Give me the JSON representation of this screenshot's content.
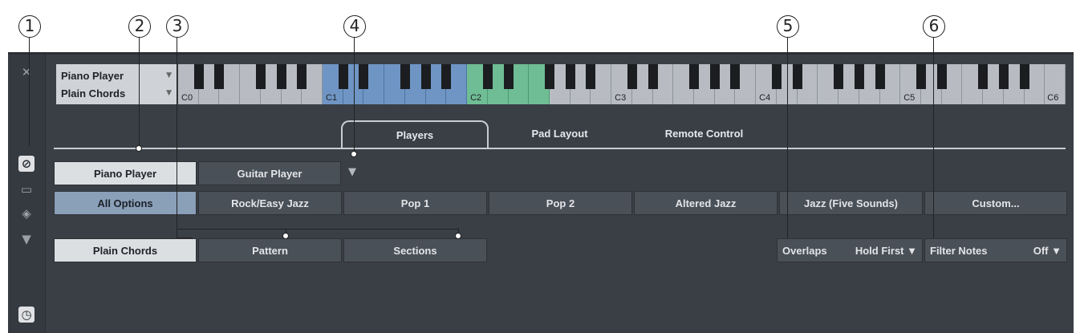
{
  "callouts": [
    "1",
    "2",
    "3",
    "4",
    "5",
    "6"
  ],
  "sidebar": {
    "close": "✕",
    "icons": [
      "edit-icon",
      "comment-icon",
      "tag-icon",
      "triangle-down-icon",
      "clock-icon"
    ]
  },
  "selectors": {
    "player": "Piano Player",
    "style": "Plain Chords"
  },
  "keyboard": {
    "octaves": [
      "C0",
      "C1",
      "C2",
      "C3",
      "C4",
      "C5",
      "C6"
    ],
    "colors": {
      "range_blue": "#6f95c4",
      "range_green": "#6fbd95"
    }
  },
  "tabs": [
    {
      "label": "Players",
      "active": true
    },
    {
      "label": "Pad Layout",
      "active": false
    },
    {
      "label": "Remote Control",
      "active": false
    }
  ],
  "players": [
    "Piano Player",
    "Guitar Player"
  ],
  "styles": [
    "All Options",
    "Rock/Easy Jazz",
    "Pop 1",
    "Pop 2",
    "Altered Jazz",
    "Jazz (Five Sounds)",
    "Custom..."
  ],
  "modes": [
    "Plain Chords",
    "Pattern",
    "Sections"
  ],
  "overlaps": {
    "label": "Overlaps",
    "value": "Hold First"
  },
  "filter_notes": {
    "label": "Filter Notes",
    "value": "Off"
  }
}
